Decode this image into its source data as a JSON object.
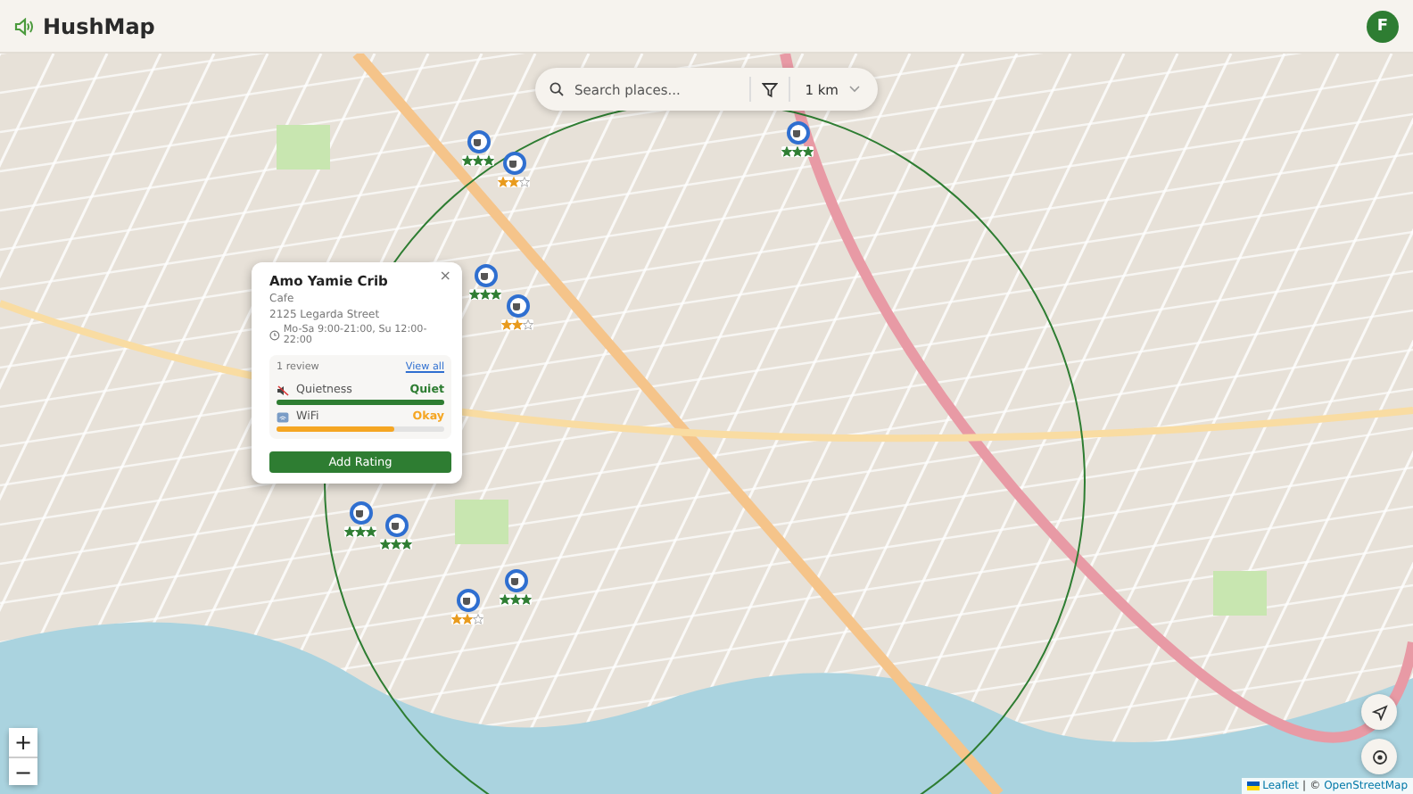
{
  "header": {
    "title": "HushMap",
    "avatar": "F"
  },
  "search": {
    "placeholder": "Search places...",
    "radius": "1 km"
  },
  "markers": [
    {
      "stars": 3
    },
    {
      "stars": 2
    },
    {
      "stars": 3
    },
    {
      "stars": 2
    },
    {
      "stars": 3
    },
    {
      "stars": 3
    },
    {
      "stars": 3
    },
    {
      "stars": 2
    },
    {
      "stars": 3
    }
  ],
  "popup": {
    "name": "Amo Yamie Crib",
    "category": "Cafe",
    "address": "2125 Legarda Street",
    "hours": "Mo-Sa 9:00-21:00, Su 12:00-22:00",
    "reviews": "1 review",
    "view_all": "View all",
    "metrics": [
      {
        "kind": "quietness",
        "label": "Quietness",
        "value": "Quiet",
        "level": 1.0,
        "color": "#2e7d32"
      },
      {
        "kind": "wifi",
        "label": "WiFi",
        "value": "Okay",
        "level": 0.7,
        "color": "#f5a623"
      }
    ],
    "button": "Add Rating",
    "close": "×"
  },
  "zoom": {
    "in": "+",
    "out": "−"
  },
  "attribution": {
    "leaflet": "Leaflet",
    "separator": "|",
    "osm_prefix": "©",
    "osm": "OpenStreetMap"
  }
}
